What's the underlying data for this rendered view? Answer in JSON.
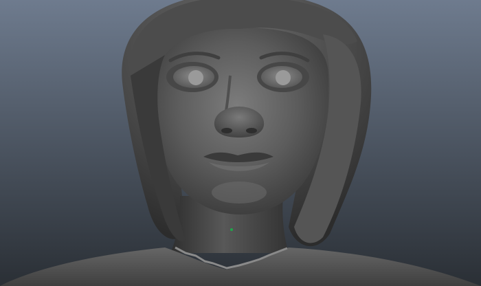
{
  "viewport": {
    "background_top_color": "#6e7b8e",
    "background_bottom_color": "#2a2f35",
    "model_shade_color": "#4a4a4a",
    "model_highlight_color": "#808080",
    "model_shadow_color": "#262626",
    "seam_color": "#8a8a8a",
    "vertex_marker_color": "#1fa64a"
  }
}
